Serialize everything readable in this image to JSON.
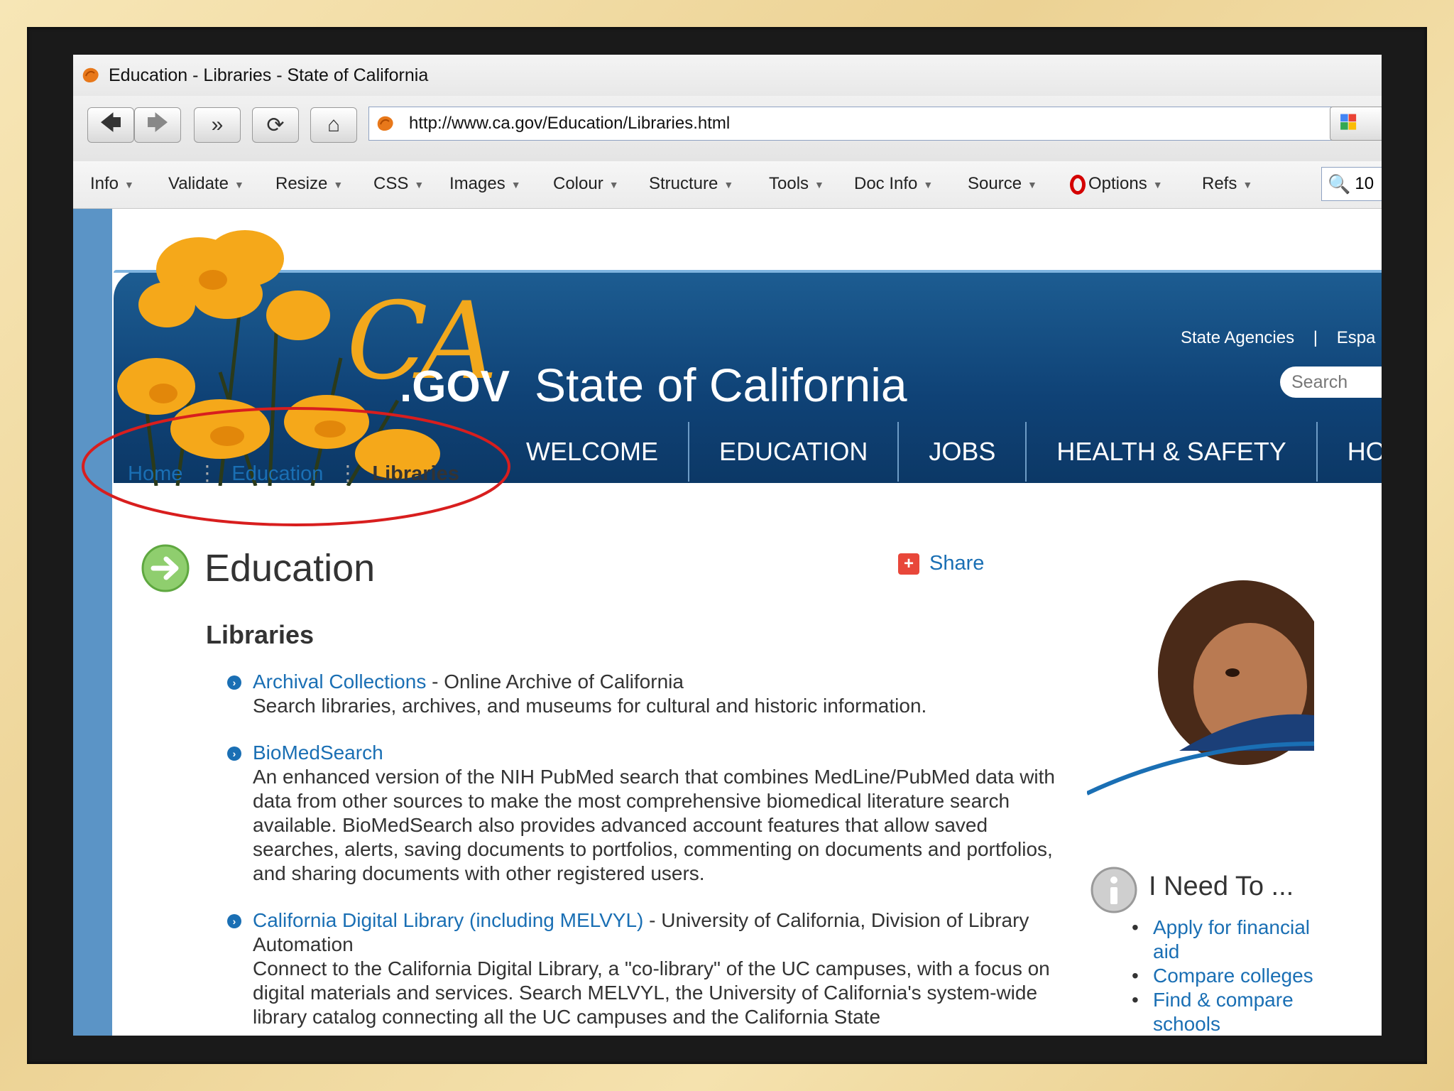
{
  "window": {
    "title": "Education - Libraries - State of California"
  },
  "browser": {
    "url": "http://www.ca.gov/Education/Libraries.html",
    "zoom_partial": "10"
  },
  "webdev_toolbar": {
    "items": [
      "Info",
      "Validate",
      "Resize",
      "CSS",
      "Images",
      "Colour",
      "Structure",
      "Tools",
      "Doc Info",
      "Source",
      "Options",
      "Refs"
    ]
  },
  "header": {
    "logo_ca": "CA",
    "logo_gov": ".GOV",
    "site_title": "State of California",
    "util_links": [
      "State Agencies",
      "|",
      "Espa"
    ],
    "search_placeholder": "Search",
    "nav": [
      "WELCOME",
      "EDUCATION",
      "JOBS",
      "HEALTH & SAFETY",
      "HOME & FAM"
    ]
  },
  "breadcrumb": {
    "home": "Home",
    "education": "Education",
    "current": "Libraries"
  },
  "main": {
    "page_title": "Education",
    "share_label": "Share",
    "section_title": "Libraries",
    "entries": [
      {
        "link": "Archival Collections",
        "suffix": " - Online Archive of California",
        "desc": "Search libraries, archives, and museums for cultural and historic information."
      },
      {
        "link": "BioMedSearch",
        "suffix": "",
        "desc": "An enhanced version of the NIH PubMed search that combines MedLine/PubMed data with data from other sources to make the most comprehensive biomedical literature search available. BioMedSearch also provides advanced account features that allow saved searches, alerts, saving documents to portfolios, commenting on documents and portfolios, and sharing documents with other registered users."
      },
      {
        "link": "California Digital Library (including MELVYL)",
        "suffix": " - University of California, Division of Library Automation",
        "desc": "Connect to the California Digital Library, a \"co-library\" of the UC campuses, with a focus on digital materials and services. Search MELVYL, the University of California's system-wide library catalog connecting all the UC campuses and the California State"
      }
    ]
  },
  "sidebar": {
    "ineed_title": "I Need To ...",
    "ineed_items": [
      "Apply for financial aid",
      "Compare colleges",
      "Find & compare schools"
    ]
  },
  "colors": {
    "link": "#1a6fb4",
    "banner": "#0f4276",
    "accent_gold": "#f2a81c",
    "annotation_red": "#d81e1e"
  }
}
